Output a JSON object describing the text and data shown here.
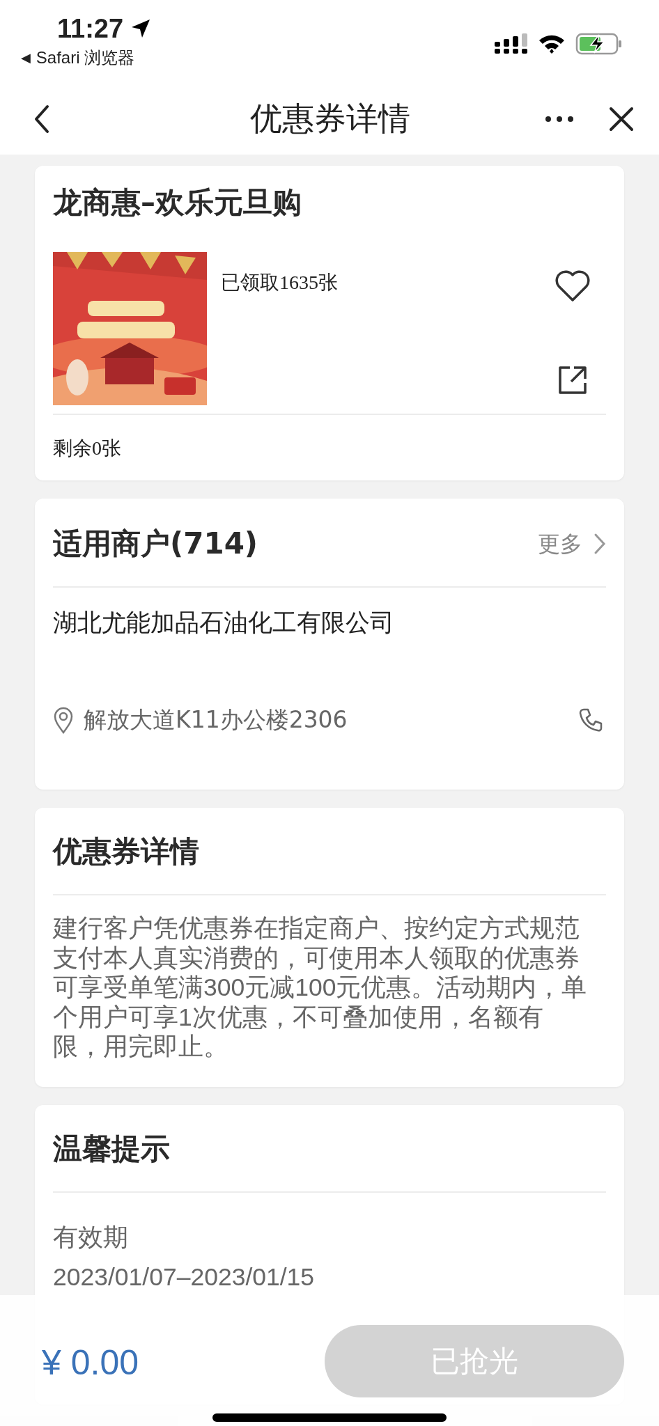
{
  "status_bar": {
    "time": "11:27",
    "back_arrow": "◀",
    "back_app": "Safari 浏览器"
  },
  "nav": {
    "title": "优惠券详情"
  },
  "coupon": {
    "title": "龙商惠–欢乐元旦购",
    "claimed": "已领取1635张",
    "favorited": false,
    "remaining": "剩余0张"
  },
  "merchants": {
    "title": "适用商户(714)",
    "more": "更多",
    "name": "湖北尤能加品石油化工有限公司",
    "address": "解放大道K11办公楼2306"
  },
  "details": {
    "title": "优惠券详情",
    "text": "建行客户凭优惠券在指定商户、按约定方式规范支付本人真实消费的，可使用本人领取的优惠券可享受单笔满300元减100元优惠。活动期内，单个用户可享1次优惠，不可叠加使用，名额有限，用完即止。"
  },
  "tips": {
    "title": "温馨提示",
    "sections": [
      {
        "heading": "有效期",
        "text": "2023/01/07–2023/01/15"
      }
    ]
  },
  "bottom_bar": {
    "price": "¥ 0.00",
    "button": {
      "label": "已抢光",
      "disabled": true
    }
  }
}
